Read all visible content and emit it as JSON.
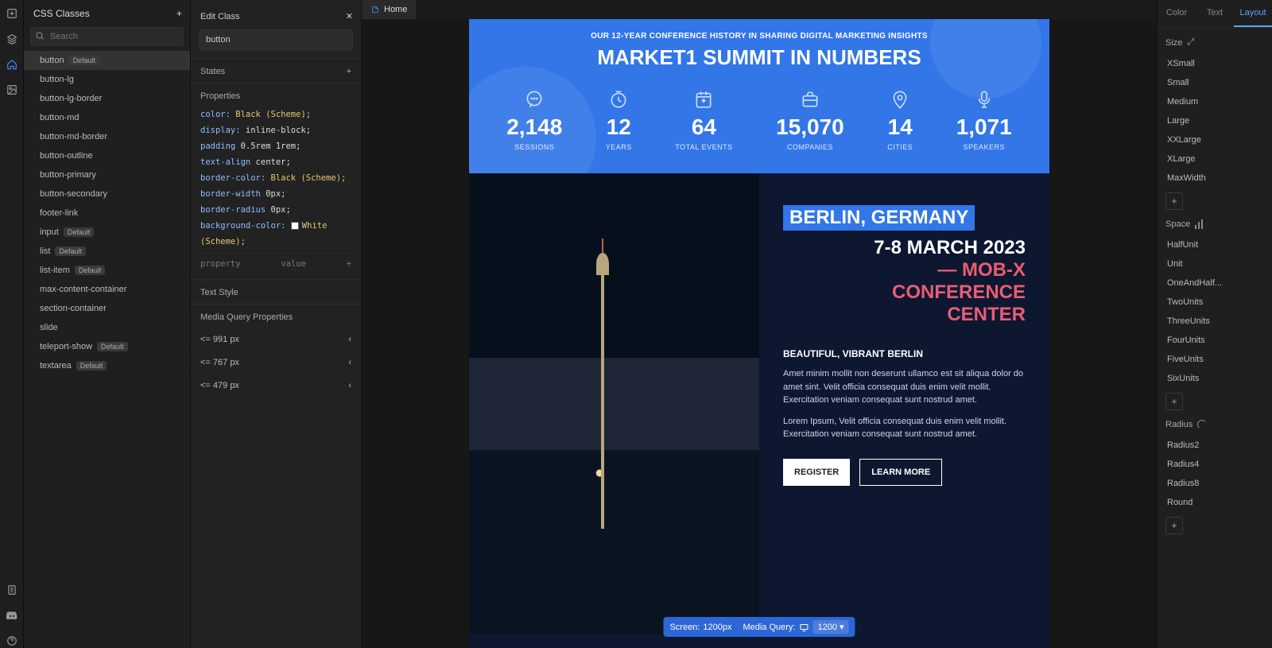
{
  "iconRail": {
    "items": [
      "plus",
      "layers",
      "home",
      "image"
    ],
    "bottom": [
      "doc",
      "discord",
      "help"
    ]
  },
  "leftPanel": {
    "title": "CSS Classes",
    "search_placeholder": "Search",
    "classes": [
      {
        "name": "button",
        "badge": "Default",
        "selected": true
      },
      {
        "name": "button-lg"
      },
      {
        "name": "button-lg-border"
      },
      {
        "name": "button-md"
      },
      {
        "name": "button-md-border"
      },
      {
        "name": "button-outline"
      },
      {
        "name": "button-primary"
      },
      {
        "name": "button-secondary"
      },
      {
        "name": "footer-link"
      },
      {
        "name": "input",
        "badge": "Default"
      },
      {
        "name": "list",
        "badge": "Default"
      },
      {
        "name": "list-item",
        "badge": "Default"
      },
      {
        "name": "max-content-container"
      },
      {
        "name": "section-container"
      },
      {
        "name": "slide"
      },
      {
        "name": "teleport-show",
        "badge": "Default"
      },
      {
        "name": "textarea",
        "badge": "Default"
      }
    ]
  },
  "editPanel": {
    "title": "Edit Class",
    "close": "✕",
    "class_name": "button",
    "states_label": "States",
    "properties_label": "Properties",
    "props": [
      {
        "k": "color:",
        "v": "Black (Scheme);",
        "scheme": true
      },
      {
        "k": "display:",
        "v": "inline-block;"
      },
      {
        "k": "padding",
        "v": "0.5rem 1rem;"
      },
      {
        "k": "text-align",
        "v": "center;"
      },
      {
        "k": "border-color:",
        "v": "Black (Scheme);",
        "scheme": true
      },
      {
        "k": "border-width",
        "v": "0px;"
      },
      {
        "k": "border-radius",
        "v": "0px;"
      },
      {
        "k": "background-color:",
        "v": "White (Scheme);",
        "scheme": true,
        "swatch": "#fff"
      }
    ],
    "add_prop_k": "property",
    "add_prop_v": "value",
    "text_style_label": "Text Style",
    "media_query_label": "Media Query Properties",
    "media_queries": [
      "<= 991 px",
      "<= 767 px",
      "<= 479 px"
    ]
  },
  "tabs": {
    "home": "Home"
  },
  "canvas": {
    "stats": {
      "sub": "OUR 12-YEAR CONFERENCE HISTORY IN SHARING DIGITAL MARKETING INSIGHTS",
      "title": "MARKET1 SUMMIT IN NUMBERS",
      "items": [
        {
          "icon": "chat",
          "num": "2,148",
          "lab": "SESSIONS"
        },
        {
          "icon": "clock",
          "num": "12",
          "lab": "YEARS"
        },
        {
          "icon": "cal",
          "num": "64",
          "lab": "TOTAL EVENTS"
        },
        {
          "icon": "work",
          "num": "15,070",
          "lab": "COMPANIES"
        },
        {
          "icon": "pin",
          "num": "14",
          "lab": "CITIES"
        },
        {
          "icon": "mic",
          "num": "1,071",
          "lab": "SPEAKERS"
        }
      ]
    },
    "event": {
      "location": "BERLIN, GERMANY",
      "date": "7-8 MARCH 2023",
      "place_a": "— MOB-X",
      "place_b": "CONFERENCE",
      "place_c": "CENTER",
      "sub": "BEAUTIFUL, VIBRANT BERLIN",
      "p1": "Amet minim mollit non deserunt ullamco est sit aliqua dolor do amet sint. Velit officia consequat duis enim velit mollit. Exercitation veniam consequat sunt nostrud amet.",
      "p2": "Lorem Ipsum, Velit officia consequat duis enim velit mollit. Exercitation veniam consequat sunt nostrud amet.",
      "btn_register": "REGISTER",
      "btn_learn": "LEARN MORE"
    },
    "screenbar": {
      "screen_label": "Screen:",
      "screen_value": "1200px",
      "mq_label": "Media Query:",
      "mq_value": "1200"
    }
  },
  "rightPanel": {
    "tabs": [
      "Color",
      "Text",
      "Layout"
    ],
    "active_tab": 2,
    "size_label": "Size",
    "sizes": [
      "XSmall",
      "Small",
      "Medium",
      "Large",
      "XXLarge",
      "XLarge",
      "MaxWidth"
    ],
    "space_label": "Space",
    "spaces": [
      "HalfUnit",
      "Unit",
      "OneAndHalf...",
      "TwoUnits",
      "ThreeUnits",
      "FourUnits",
      "FiveUnits",
      "SixUnits"
    ],
    "radius_label": "Radius",
    "radii": [
      "Radius2",
      "Radius4",
      "Radius8",
      "Round"
    ]
  }
}
